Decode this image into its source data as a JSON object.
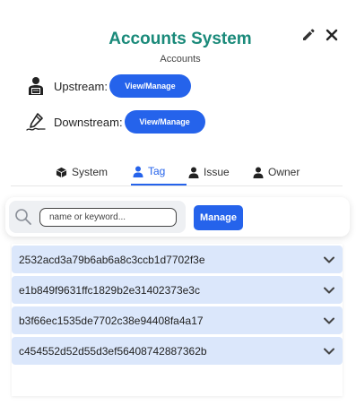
{
  "header": {
    "title": "Accounts System",
    "subtitle": "Accounts",
    "edit_icon": "pencil-icon",
    "close_icon": "close-icon"
  },
  "upstream": {
    "label": "Upstream:",
    "button_label": "View/Manage"
  },
  "downstream": {
    "label": "Downstream:",
    "button_label": "View/Manage"
  },
  "tabs": [
    {
      "label": "System",
      "icon": "cube-icon",
      "active": false
    },
    {
      "label": "Tag",
      "icon": "user-icon",
      "active": true
    },
    {
      "label": "Issue",
      "icon": "user-icon",
      "active": false
    },
    {
      "label": "Owner",
      "icon": "user-icon",
      "active": false
    }
  ],
  "search": {
    "placeholder": "name or keyword...",
    "value": "",
    "manage_label": "Manage"
  },
  "items": [
    {
      "label": "2532acd3a79b6ab6a8c3ccb1d7702f3e"
    },
    {
      "label": "e1b849f9631ffc1829b2e31402373e3c"
    },
    {
      "label": "b3f66ec1535de7702c38e94408fa4a17"
    },
    {
      "label": "c454552d52d55d3ef56408742887362b"
    }
  ],
  "colors": {
    "accent": "#2563eb",
    "title": "#1a8a7a",
    "item_bg": "#dbe7fb"
  }
}
